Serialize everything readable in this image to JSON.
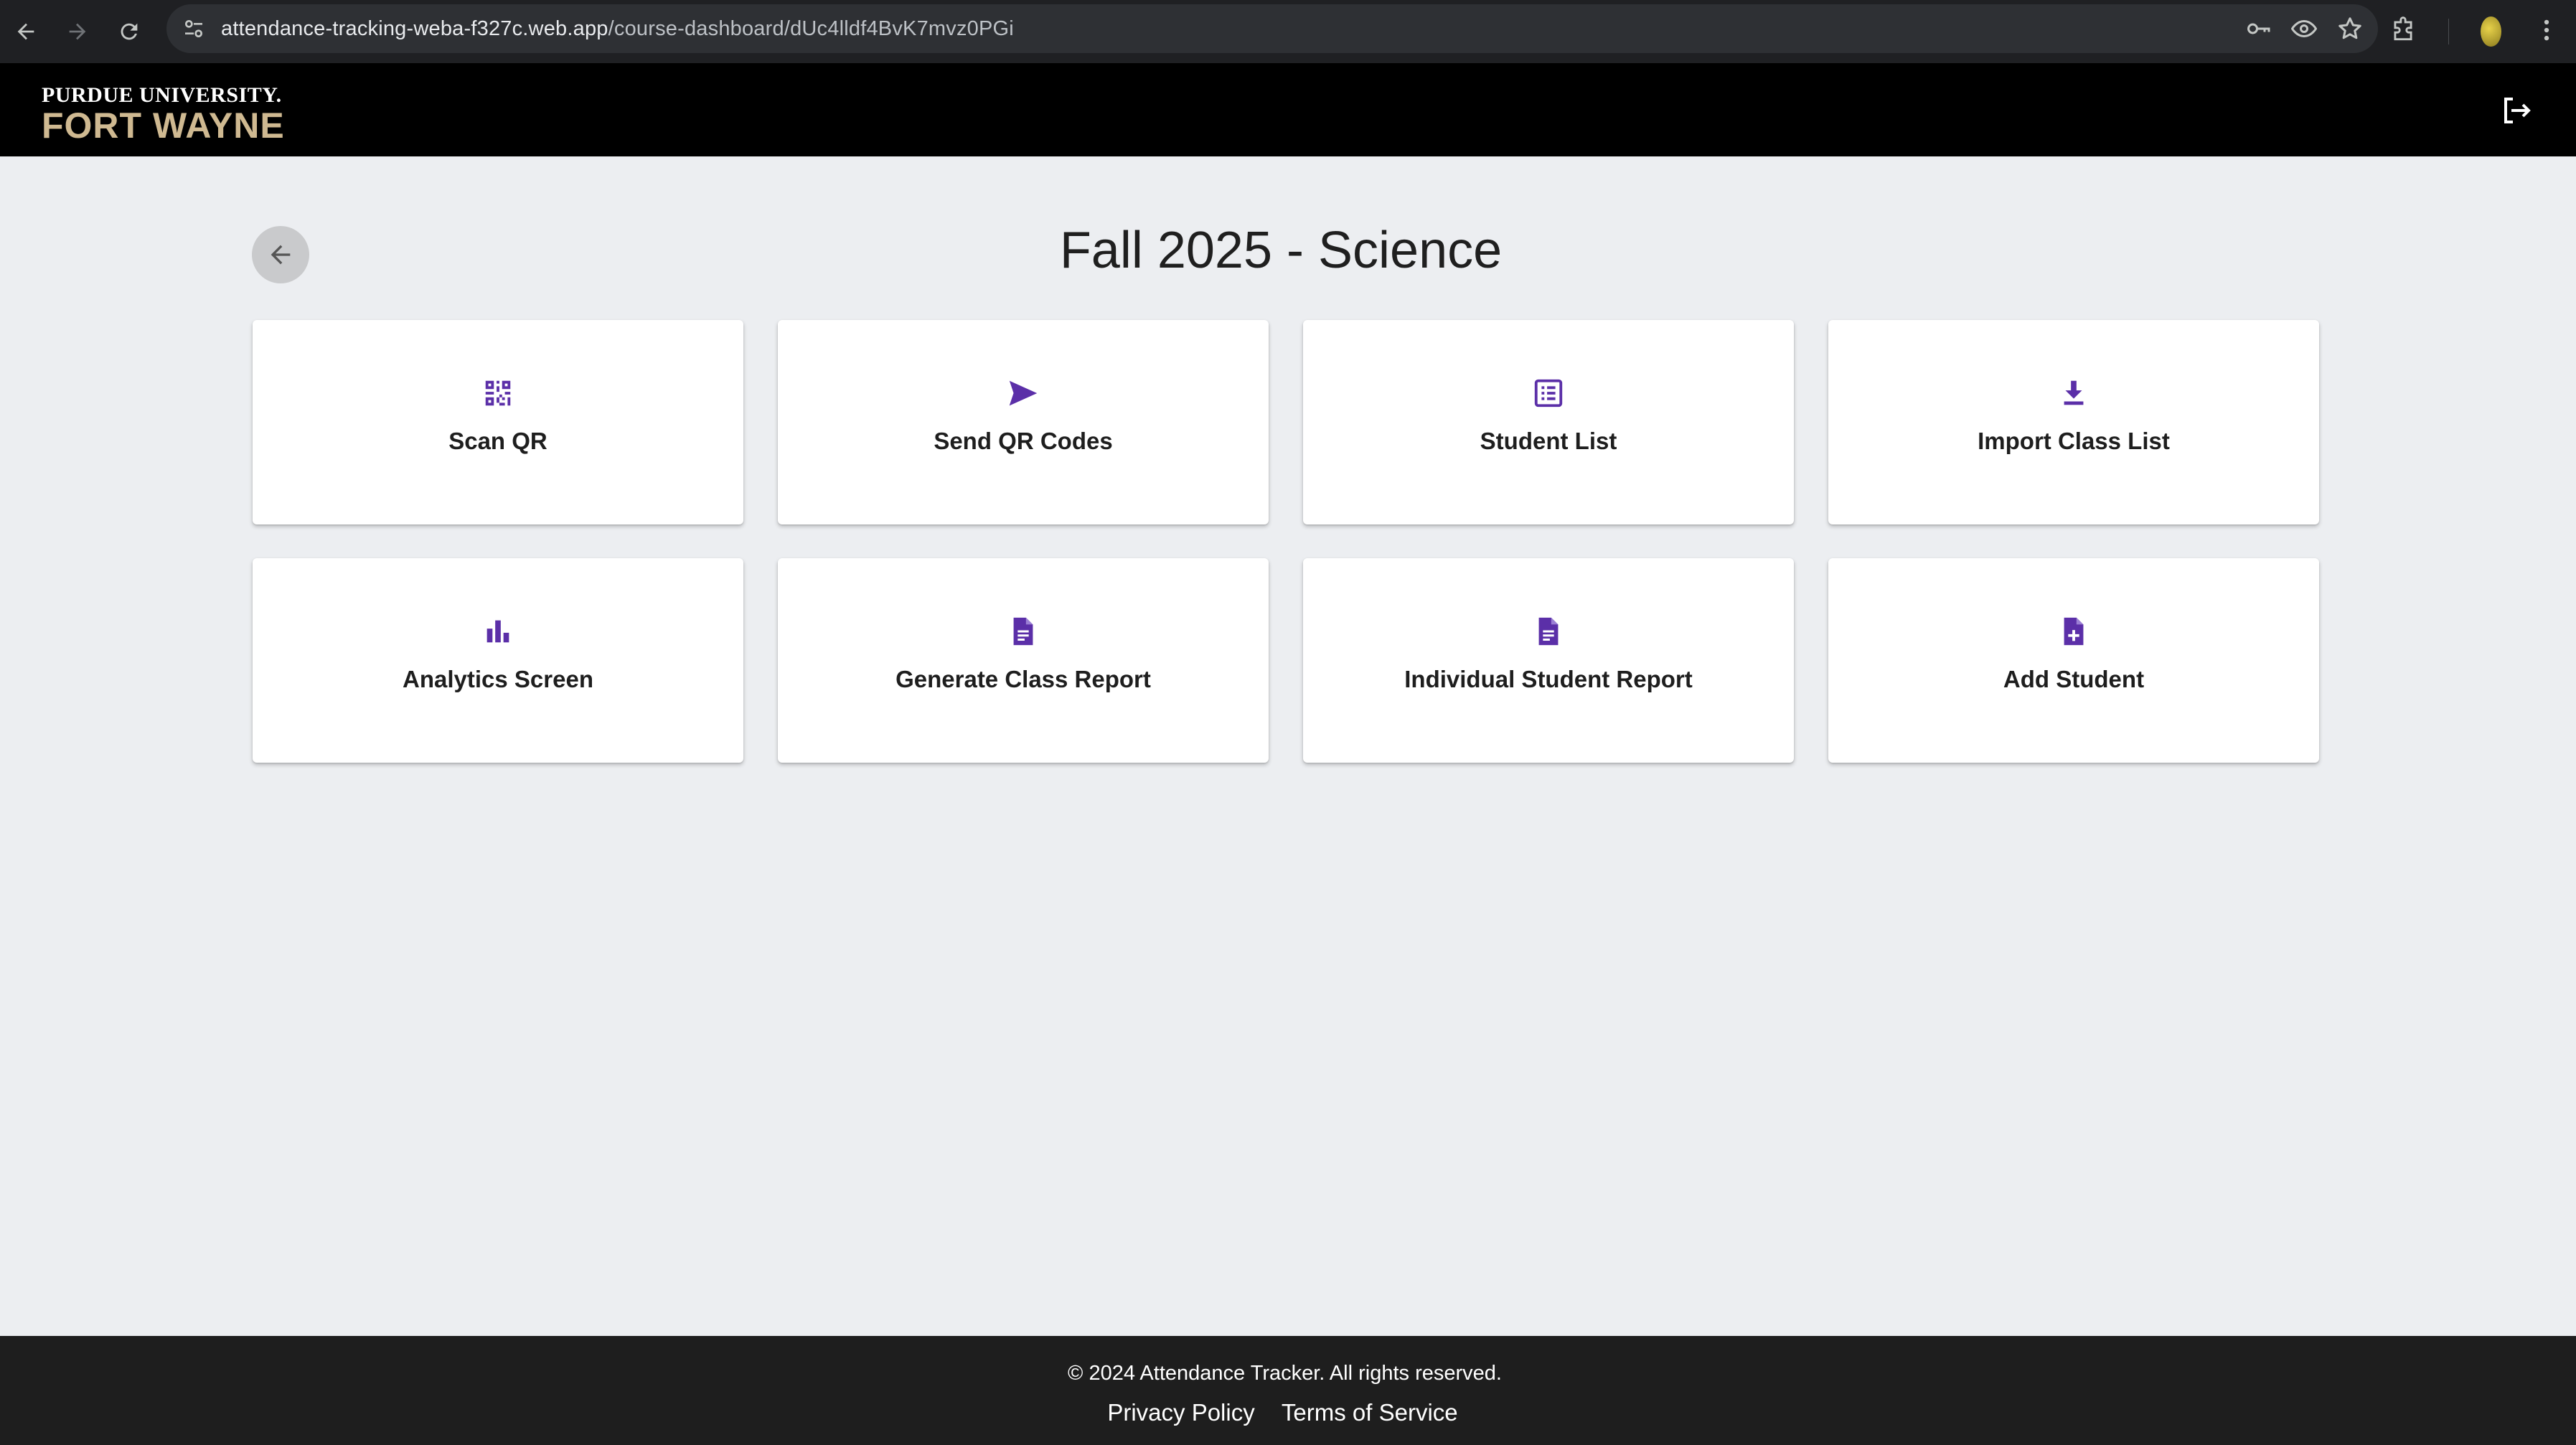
{
  "browser": {
    "url_host": "attendance-tracking-weba-f327c.web.app",
    "url_path": "/course-dashboard/dUc4lldf4BvK7mvz0PGi",
    "icons": [
      "back-arrow-icon",
      "forward-arrow-icon",
      "reload-icon",
      "site-settings-icon",
      "key-icon",
      "eye-icon",
      "star-icon",
      "extensions-icon",
      "profile-avatar",
      "more-vert-icon"
    ]
  },
  "header": {
    "logo_top": "PURDUE UNIVERSITY.",
    "logo_bottom": "FORT WAYNE",
    "logout_icon": "logout-icon"
  },
  "main": {
    "title": "Fall 2025 - Science",
    "back_icon": "arrow-left-icon",
    "accent_color": "#5b2fa8",
    "cards": [
      {
        "label": "Scan QR",
        "icon": "qr-scan-icon"
      },
      {
        "label": "Send QR Codes",
        "icon": "send-icon"
      },
      {
        "label": "Student List",
        "icon": "list-icon"
      },
      {
        "label": "Import Class List",
        "icon": "download-icon"
      },
      {
        "label": "Analytics Screen",
        "icon": "bar-chart-icon"
      },
      {
        "label": "Generate Class Report",
        "icon": "document-icon"
      },
      {
        "label": "Individual Student Report",
        "icon": "document-icon"
      },
      {
        "label": "Add Student",
        "icon": "document-add-icon"
      }
    ]
  },
  "footer": {
    "copyright": "© 2024 Attendance Tracker. All rights reserved.",
    "privacy": "Privacy Policy",
    "terms": "Terms of Service"
  }
}
